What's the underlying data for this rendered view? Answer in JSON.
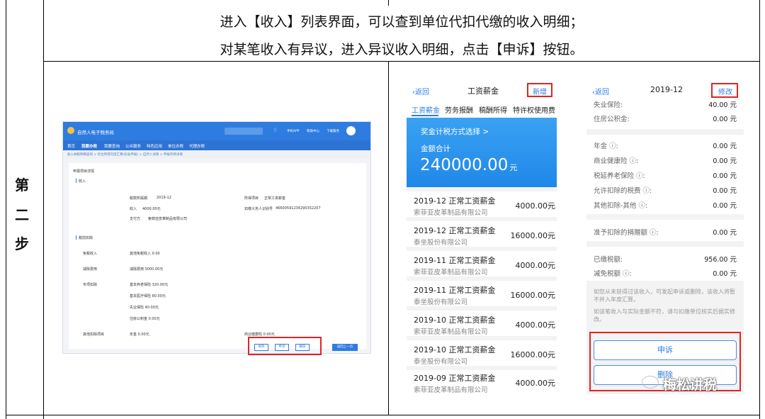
{
  "instructions": {
    "line1": "进入【收入】列表界面，可以查到单位代扣代缴的收入明细；",
    "line2": "对某笔收入有异议，进入异议收入明细，点击【申诉】按钮。"
  },
  "step_label": [
    "第",
    "二",
    "步"
  ],
  "desktop": {
    "app_name": "自然人电子税务局",
    "header_links": [
      "手机APP",
      "帮助中心",
      "下载服务"
    ],
    "nav": [
      "首页",
      "我要办税",
      "我要查询",
      "公众服务",
      "特色应用",
      "单位办税",
      "代理办税"
    ],
    "breadcrumb": "收入纳税明细查询 > 综合所得年度汇算(标准申报) > 自然人详情 > 申报项目详情",
    "section_title": "申报项目详情",
    "income_title": "收入",
    "fields": [
      {
        "label": "税款所属期",
        "value": "2019-12"
      },
      {
        "label": "所得项目",
        "value": "正常工资薪金"
      },
      {
        "label": "收入",
        "value": "4000.00元"
      },
      {
        "label": "扣缴义务人识别号",
        "value": "46600591234290352207"
      },
      {
        "label": "支付方",
        "value": "索菲亚皮革制品有限公司"
      }
    ],
    "deduct_title": "税前扣除",
    "deduct_rows": [
      {
        "label": "免税收入",
        "value": "其他免税收入  0.00"
      },
      {
        "label": "减除费用",
        "value": "减除费用  5000.00元"
      },
      {
        "label": "专项扣除",
        "value": "基本养老保险  320.00元"
      },
      {
        "label": "",
        "value": "基本医疗保险  80.00元"
      },
      {
        "label": "",
        "value": "失业保险  40.00元"
      },
      {
        "label": "",
        "value": "住房公积金  0.00元"
      },
      {
        "label": "其他扣除项目",
        "value": "年金  0.00元"
      }
    ],
    "extra_field": "商业健康险  0.00元",
    "buttons": {
      "modify": "修改",
      "appeal": "申诉",
      "delete": "删除",
      "back": "返回上一页"
    }
  },
  "phone1": {
    "back": "返回",
    "title": "工资薪金",
    "action": "新增",
    "tabs": [
      "工资薪金",
      "劳务报酬",
      "稿酬所得",
      "特许权使用费"
    ],
    "banner_link": "奖金计税方式选择 >",
    "total_label": "金额合计",
    "total_value": "240000.00",
    "total_unit": "元",
    "rows": [
      {
        "title": "2019-12 正常工资薪金",
        "company": "索菲亚皮革制品有限公司",
        "amount": "4000.00元"
      },
      {
        "title": "2019-12 正常工资薪金",
        "company": "泰坐股份有限公司",
        "amount": "16000.00元"
      },
      {
        "title": "2019-11 正常工资薪金",
        "company": "索菲亚皮革制品有限公司",
        "amount": "4000.00元"
      },
      {
        "title": "2019-11 正常工资薪金",
        "company": "泰坐股份有限公司",
        "amount": "16000.00元"
      },
      {
        "title": "2019-10 正常工资薪金",
        "company": "索菲亚皮革制品有限公司",
        "amount": "4000.00元"
      },
      {
        "title": "2019-10 正常工资薪金",
        "company": "泰坐股份有限公司",
        "amount": "16000.00元"
      },
      {
        "title": "2019-09 正常工资薪金",
        "company": "索菲亚皮革制品有限公司",
        "amount": "4000.00元"
      }
    ]
  },
  "phone2": {
    "back": "返回",
    "title": "2019-12",
    "action": "修改",
    "group1": [
      {
        "label": "失业保险:",
        "value": "40.00 元"
      },
      {
        "label": "住房公积金:",
        "value": "0.00 元"
      }
    ],
    "group2": [
      {
        "label": "年金 ⓘ:",
        "value": "0.00 元"
      },
      {
        "label": "商业健康险 ⓘ:",
        "value": "0.00 元"
      },
      {
        "label": "税延养老保险 ⓘ:",
        "value": "0.00 元"
      },
      {
        "label": "允许扣除的税费 ⓘ:",
        "value": "0.00 元"
      },
      {
        "label": "其他扣除-其他 ⓘ:",
        "value": "0.00 元"
      }
    ],
    "group3": [
      {
        "label": "准予扣除的捐赠额 ⓘ:",
        "value": "0.00 元"
      }
    ],
    "group4": [
      {
        "label": "已缴税额:",
        "value": "956.00 元"
      },
      {
        "label": "减免税额 ⓘ:",
        "value": "0.00 元"
      }
    ],
    "note1": "如您从未获得过该收入，可发起申诉或删除，该收入将暂不并入年度汇算。",
    "note2": "如该笔收入与实际金额不符，请与扣缴单位核实后据实修改。",
    "appeal_button": "申诉",
    "delete_button": "删除"
  },
  "watermark": "梅松讲税"
}
